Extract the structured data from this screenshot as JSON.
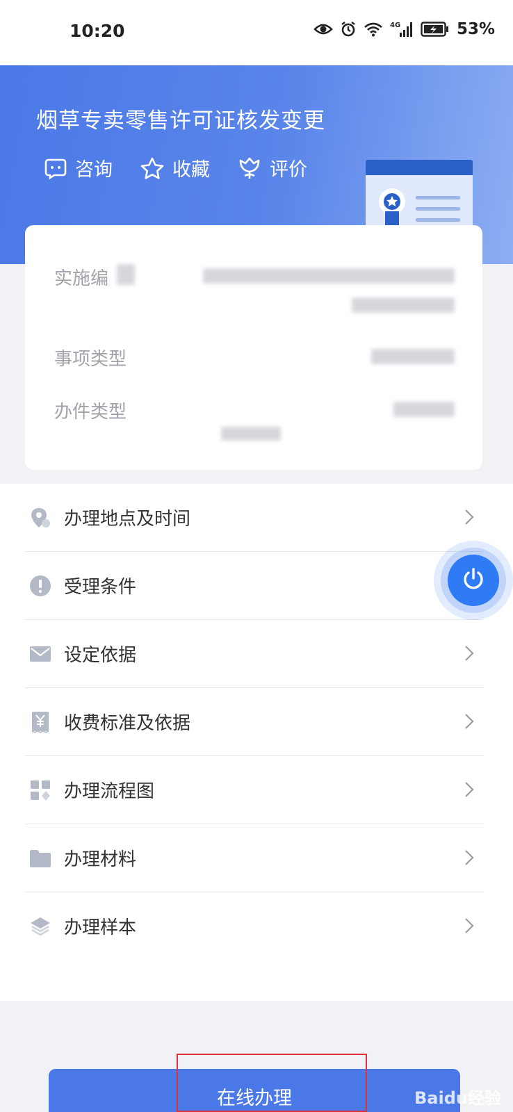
{
  "status_bar": {
    "time": "10:20",
    "network": "4G",
    "battery": "53%"
  },
  "header": {
    "title": "烟草专卖零售许可证核发变更",
    "actions": [
      {
        "label": "咨询",
        "icon": "chat-icon"
      },
      {
        "label": "收藏",
        "icon": "star-icon"
      },
      {
        "label": "评价",
        "icon": "flower-icon"
      }
    ]
  },
  "info_card": {
    "rows": [
      {
        "label": "实施编"
      },
      {
        "label": "事项类型"
      },
      {
        "label": "办件类型"
      }
    ]
  },
  "menu": {
    "items": [
      {
        "label": "办理地点及时间",
        "icon": "location-icon"
      },
      {
        "label": "受理条件",
        "icon": "exclamation-icon"
      },
      {
        "label": "设定依据",
        "icon": "envelope-icon"
      },
      {
        "label": "收费标准及依据",
        "icon": "yen-icon"
      },
      {
        "label": "办理流程图",
        "icon": "grid-icon"
      },
      {
        "label": "办理材料",
        "icon": "folder-icon"
      },
      {
        "label": "办理样本",
        "icon": "layers-icon"
      }
    ]
  },
  "actions": {
    "online_handle": "在线办理"
  },
  "watermark": "Baidu经验",
  "colors": {
    "accent": "#4a78e6",
    "float_button": "#2f7af5",
    "highlight_box": "#e0323a"
  }
}
